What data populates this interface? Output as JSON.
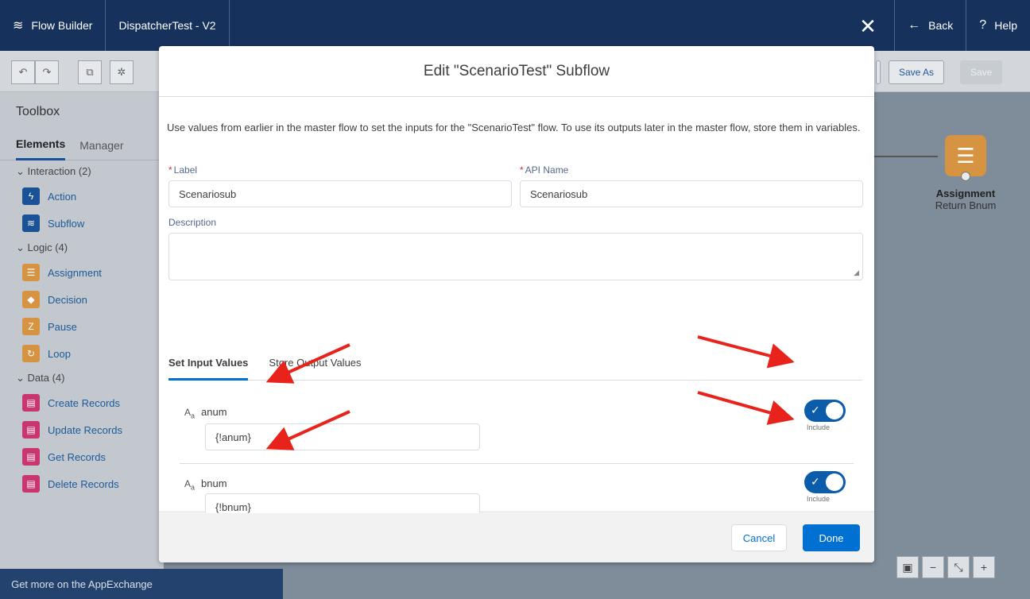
{
  "topbar": {
    "app_name": "Flow Builder",
    "flow_name": "DispatcherTest - V2",
    "back_label": "Back",
    "help_label": "Help"
  },
  "toolbar": {
    "save_as_label": "Save As",
    "save_label": "Save"
  },
  "toolbox": {
    "title": "Toolbox",
    "tabs": [
      "Elements",
      "Manager"
    ],
    "sections": [
      {
        "label": "Interaction (2)",
        "items": [
          {
            "label": "Action",
            "icon": "lightning-icon",
            "color": "#1b5297"
          },
          {
            "label": "Subflow",
            "icon": "subflow-icon",
            "color": "#1b5297"
          }
        ]
      },
      {
        "label": "Logic (4)",
        "items": [
          {
            "label": "Assignment",
            "icon": "assignment-icon",
            "color": "#d69442"
          },
          {
            "label": "Decision",
            "icon": "decision-icon",
            "color": "#d69442"
          },
          {
            "label": "Pause",
            "icon": "pause-icon",
            "color": "#d69442"
          },
          {
            "label": "Loop",
            "icon": "loop-icon",
            "color": "#d69442"
          }
        ]
      },
      {
        "label": "Data (4)",
        "items": [
          {
            "label": "Create Records",
            "icon": "create-records-icon",
            "color": "#c9356f"
          },
          {
            "label": "Update Records",
            "icon": "update-records-icon",
            "color": "#c9356f"
          },
          {
            "label": "Get Records",
            "icon": "get-records-icon",
            "color": "#c9356f"
          },
          {
            "label": "Delete Records",
            "icon": "delete-records-icon",
            "color": "#c9356f"
          }
        ]
      }
    ],
    "footer": "Get more on the AppExchange"
  },
  "canvas": {
    "assignment_title": "Assignment",
    "assignment_subtitle": "Return Bnum"
  },
  "modal": {
    "title": "Edit \"ScenarioTest\" Subflow",
    "intro": "Use values from earlier in the master flow to set the inputs for the \"ScenarioTest\" flow. To use its outputs later in the master flow, store them in variables.",
    "label_label": "Label",
    "label_value": "Scenariosub",
    "api_name_label": "API Name",
    "api_name_value": "Scenariosub",
    "description_label": "Description",
    "description_value": "",
    "required_marker": "*",
    "tabs": [
      "Set Input Values",
      "Store Output Values"
    ],
    "inputs": [
      {
        "name": "anum",
        "value": "{!anum}",
        "include_label": "Include"
      },
      {
        "name": "bnum",
        "value": "{!bnum}",
        "include_label": "Include"
      }
    ],
    "cancel_label": "Cancel",
    "done_label": "Done"
  },
  "colors": {
    "brand": "#0070d2",
    "topbar": "#16325c",
    "annotation": "#e8231c"
  }
}
